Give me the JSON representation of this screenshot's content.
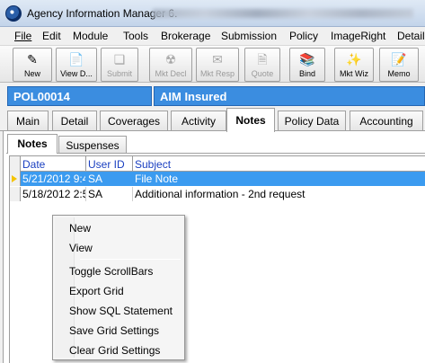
{
  "window": {
    "title": "Agency Information Manager 6."
  },
  "menubar": {
    "items": [
      "File",
      "Edit",
      "Module",
      "Tools",
      "Brokerage",
      "Submission",
      "Policy",
      "ImageRight",
      "Detail"
    ]
  },
  "toolbar": {
    "buttons": [
      {
        "label": "New",
        "icon": "new-document-icon",
        "enabled": true
      },
      {
        "label": "View D...",
        "icon": "view-document-icon",
        "enabled": true
      },
      {
        "label": "Submit",
        "icon": "submit-icon",
        "enabled": false
      },
      {
        "label": "Mkt Decl",
        "icon": "market-decline-icon",
        "enabled": false
      },
      {
        "label": "Mkt Resp",
        "icon": "market-response-icon",
        "enabled": false
      },
      {
        "label": "Quote",
        "icon": "quote-icon",
        "enabled": false
      },
      {
        "label": "Bind",
        "icon": "bind-icon",
        "enabled": true
      },
      {
        "label": "Mkt Wiz",
        "icon": "market-wizard-icon",
        "enabled": true
      },
      {
        "label": "Memo",
        "icon": "memo-icon",
        "enabled": true
      }
    ]
  },
  "header": {
    "policy_number": "POL00014",
    "insured": "AIM Insured"
  },
  "tabs": [
    "Main",
    "Detail",
    "Coverages",
    "Activity",
    "Notes",
    "Policy Data",
    "Accounting"
  ],
  "active_tab": "Notes",
  "subtabs": [
    "Notes",
    "Suspenses"
  ],
  "active_subtab": "Notes",
  "grid": {
    "columns": [
      "Date",
      "User ID",
      "Subject"
    ],
    "rows": [
      {
        "date": "5/21/2012 9:4",
        "user": "SA",
        "subject": "File Note",
        "selected": true
      },
      {
        "date": "5/18/2012 2:5",
        "user": "SA",
        "subject": "Additional information - 2nd request",
        "selected": false
      }
    ]
  },
  "context_menu": {
    "items": [
      "New",
      "View",
      "Toggle ScrollBars",
      "Export Grid",
      "Show SQL Statement",
      "Save Grid Settings",
      "Clear Grid Settings"
    ]
  },
  "colors": {
    "header_blue": "#3b8de0",
    "selection_blue": "#3b9bf0",
    "column_header_text": "#1a3fc0",
    "row_marker": "#f5c400"
  }
}
